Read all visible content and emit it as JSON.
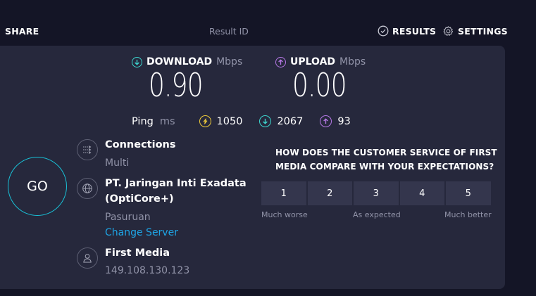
{
  "topbar": {
    "share_label": "SHARE",
    "result_id_label": "Result ID",
    "results_label": "RESULTS",
    "settings_label": "SETTINGS"
  },
  "download": {
    "label": "DOWNLOAD",
    "unit": "Mbps",
    "value": "0.90",
    "icon": "arrow-down-circle-icon",
    "color": "#3dd6cf"
  },
  "upload": {
    "label": "UPLOAD",
    "unit": "Mbps",
    "value": "0.00",
    "icon": "arrow-up-circle-icon",
    "color": "#b678e6"
  },
  "ping": {
    "label": "Ping",
    "unit": "ms",
    "idle": "1050",
    "download": "2067",
    "upload": "93",
    "idle_color": "#f0cc3a"
  },
  "go_label": "GO",
  "connection": {
    "title": "Connections",
    "value": "Multi"
  },
  "server": {
    "name_line1": "PT. Jaringan Inti Exadata",
    "name_line2": "(OptiCore+)",
    "location": "Pasuruan",
    "change_label": "Change Server"
  },
  "isp": {
    "name": "First Media",
    "ip": "149.108.130.123"
  },
  "survey": {
    "question_line1": "HOW DOES THE CUSTOMER SERVICE OF FIRST",
    "question_line2": "MEDIA COMPARE WITH YOUR EXPECTATIONS?",
    "options": [
      "1",
      "2",
      "3",
      "4",
      "5"
    ],
    "label_low": "Much worse",
    "label_mid": "As expected",
    "label_high": "Much better"
  }
}
